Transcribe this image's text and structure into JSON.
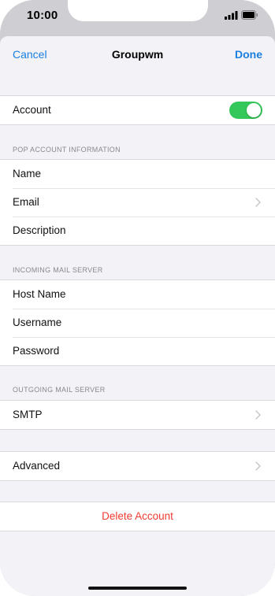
{
  "status_bar": {
    "time": "10:00"
  },
  "nav": {
    "cancel": "Cancel",
    "title": "Groupwm",
    "done": "Done"
  },
  "account": {
    "label": "Account",
    "toggle_on": true
  },
  "pop_section": {
    "header": "POP ACCOUNT INFORMATION",
    "items": [
      {
        "label": "Name"
      },
      {
        "label": "Email"
      },
      {
        "label": "Description"
      }
    ]
  },
  "incoming_section": {
    "header": "INCOMING MAIL SERVER",
    "items": [
      {
        "label": "Host Name"
      },
      {
        "label": "Username"
      },
      {
        "label": "Password"
      }
    ]
  },
  "outgoing_section": {
    "header": "OUTGOING MAIL SERVER",
    "items": [
      {
        "label": "SMTP"
      }
    ]
  },
  "advanced": {
    "label": "Advanced"
  },
  "delete": {
    "label": "Delete Account"
  },
  "colors": {
    "accent": "#1a7fe0",
    "toggle": "#34c759",
    "destructive": "#ee3b32",
    "background": "#f2f2f7"
  }
}
